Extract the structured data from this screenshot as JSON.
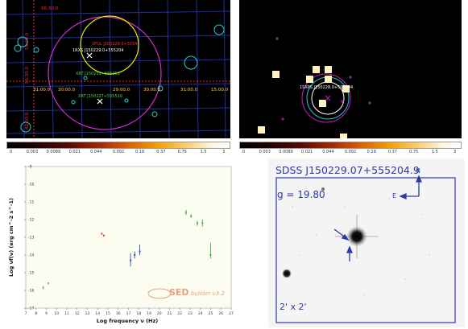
{
  "top_left_map": {
    "dec_labels": [
      "56:30.0",
      "56:00.0",
      "55:30.0",
      "42:00.0"
    ],
    "ra_labels": [
      "31:00.0",
      "30:00.0",
      "29:00.0",
      "30:00.0",
      "31:00.0",
      "15:00.0"
    ],
    "sources": {
      "rosat": "1RXS J150229.0+555204",
      "xrt1": "XRT J150231+555251",
      "xrt2": "XRT J150227+555510",
      "red": "1FGL J150229.0+5554"
    }
  },
  "top_right_map": {
    "source_label": "1SXPS J150228.0+555204"
  },
  "colorbar": {
    "ticks": [
      "0",
      "0.003",
      "0.0089",
      "0.021",
      "0.044",
      "0.092",
      "0.19",
      "0.37",
      "0.75",
      "1.5",
      "3"
    ]
  },
  "sed_plot": {
    "ylabel": "Log νf(ν) (erg cm^-2 s^-1)",
    "xlabel": "Log frequency ν (Hz)",
    "xticks": [
      "7",
      "8",
      "9",
      "10",
      "11",
      "12",
      "13",
      "14",
      "15",
      "16",
      "17",
      "18",
      "19",
      "20",
      "21",
      "22",
      "23",
      "24",
      "25",
      "26",
      "27"
    ],
    "yticks": [
      "-9",
      "-10",
      "-11",
      "-12",
      "-13",
      "-14",
      "-15",
      "-16",
      "-17"
    ],
    "watermark_brand": "SED",
    "watermark_text": "builder v3.2",
    "chart_data": {
      "type": "scatter",
      "xlim": [
        7,
        27
      ],
      "ylim": [
        -17,
        -9
      ],
      "points": [
        {
          "x": 8.7,
          "y": -15.85,
          "ylo": -15.95,
          "yhi": -15.75,
          "color": "#9c9c9c"
        },
        {
          "x": 9.2,
          "y": -15.6,
          "ylo": -15.65,
          "yhi": -15.55,
          "color": "#9c9c9c"
        },
        {
          "x": 14.4,
          "y": -12.8,
          "ylo": -12.85,
          "yhi": -12.75,
          "color": "#d94c1a"
        },
        {
          "x": 14.6,
          "y": -12.9,
          "ylo": -12.95,
          "yhi": -12.85,
          "color": "#d94c1a"
        },
        {
          "x": 17.2,
          "y": -14.3,
          "ylo": -14.65,
          "yhi": -13.9,
          "color": "#3050b0"
        },
        {
          "x": 17.6,
          "y": -14.0,
          "ylo": -14.2,
          "yhi": -13.8,
          "color": "#3050b0"
        },
        {
          "x": 18.1,
          "y": -13.8,
          "ylo": -14.0,
          "yhi": -13.4,
          "color": "#3050b0"
        },
        {
          "x": 22.6,
          "y": -11.6,
          "ylo": -11.75,
          "yhi": -11.45,
          "color": "#44b044"
        },
        {
          "x": 23.1,
          "y": -11.8,
          "ylo": -11.9,
          "yhi": -11.7,
          "color": "#44b044"
        },
        {
          "x": 23.7,
          "y": -12.2,
          "ylo": -12.35,
          "yhi": -12.05,
          "color": "#44b044"
        },
        {
          "x": 24.2,
          "y": -12.2,
          "ylo": -12.4,
          "yhi": -12.0,
          "color": "#44b044"
        },
        {
          "x": 25.0,
          "y": -14.0,
          "ylo": -14.2,
          "yhi": -13.3,
          "color": "#44b044"
        }
      ]
    }
  },
  "sdss_panel": {
    "title": "SDSS J150229.07+555204.9",
    "gmag": "g = 19.80",
    "north": "N",
    "east": "E",
    "scale": "2' x 2'"
  }
}
